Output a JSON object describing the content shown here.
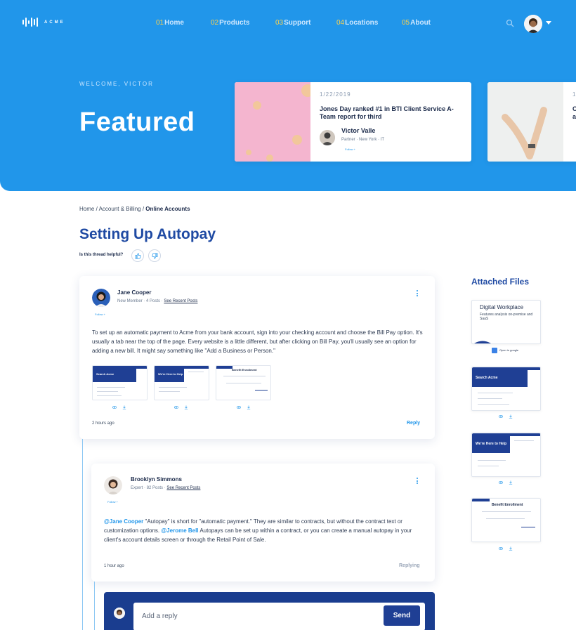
{
  "brand": {
    "name": "ACME"
  },
  "nav": [
    {
      "num": "01",
      "label": "Home"
    },
    {
      "num": "02",
      "label": "Products"
    },
    {
      "num": "03",
      "label": "Support"
    },
    {
      "num": "04",
      "label": "Locations"
    },
    {
      "num": "05",
      "label": "About"
    }
  ],
  "hero": {
    "welcome": "WELCOME, VICTOR",
    "title": "Featured",
    "cards": [
      {
        "date": "1/22/2019",
        "title": "Jones Day ranked #1 in BTI Client Service A-Team report for third",
        "author": "Victor Valle",
        "role": "Partner",
        "city": "New York",
        "dept": "IT",
        "follow": "Follow +"
      },
      {
        "date": "1",
        "title": "C a"
      }
    ]
  },
  "breadcrumb": {
    "part1": "Home",
    "part2": "Account & Billing",
    "current": "Online Accounts",
    "sep": " / "
  },
  "page": {
    "title": "Setting Up Autopay",
    "helpful_label": "Is this thread helpful?"
  },
  "posts": [
    {
      "author": "Jane Cooper",
      "rank": "New Member",
      "posts": "4 Posts",
      "recent": "See Recent Posts",
      "follow": "Follow +",
      "body": "To set up an automatic payment to Acme from your bank account, sign into your checking account and choose the Bill Pay option. It's usually a tab near the top of the page. Every website is a little different, but after clicking on Bill Pay, you'll usually see an option for adding a new bill. It might say something like \"Add a Business or Person.\"",
      "time": "2 hours ago",
      "action": "Reply",
      "attachments": [
        "Search Acme",
        "We're Here to Help",
        "Benefit Enrollment"
      ]
    },
    {
      "author": "Brooklyn Simmons",
      "rank": "Expert",
      "posts": "82 Posts",
      "recent": "See Recent Posts",
      "follow": "Follow +",
      "mention1": "@Jane Cooper",
      "body1": " \"Autopay\" is short for \"automatic payment.\" They are similar to contracts, but without the contract text or customization options. ",
      "mention2": "@Jerome Bell",
      "body2": " Autopays can be set up within a contract, or you can create a manual autopay in your client's account details screen or through the Retail Point of Sale.",
      "time": "1 hour ago",
      "action": "Replying"
    }
  ],
  "reply": {
    "placeholder": "Add a reply",
    "send": "Send"
  },
  "attached": {
    "title": "Attached Files",
    "doc": {
      "title": "Digital Workplace",
      "sub": "Features analysis on-premise and SaaS",
      "open": "Open in google"
    },
    "shots": [
      "Search Acme",
      "We're Here to Help",
      "Benefit Enrollment"
    ]
  },
  "colors": {
    "hero": "#2196ea",
    "accent": "#1f4aa3",
    "link": "#2196ea",
    "reply_bar": "#1a3d8f"
  }
}
